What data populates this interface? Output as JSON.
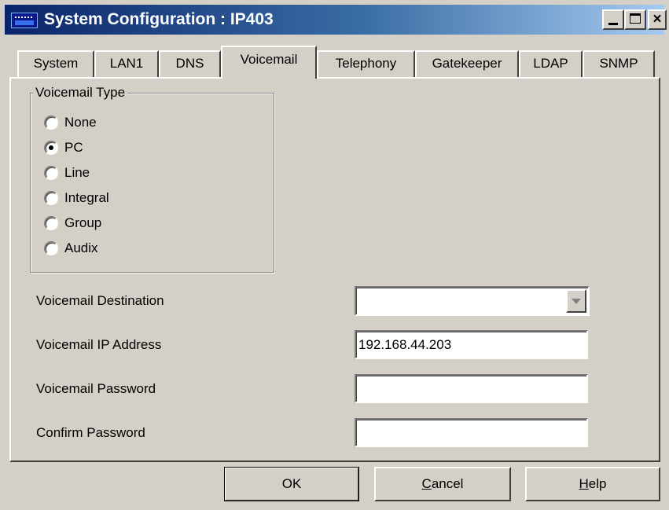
{
  "window": {
    "title": "System Configuration : IP403",
    "controls": {
      "minimize": "_",
      "maximize": "□",
      "close": "×"
    }
  },
  "tabs": [
    {
      "label": "System",
      "active": false
    },
    {
      "label": "LAN1",
      "active": false
    },
    {
      "label": "DNS",
      "active": false
    },
    {
      "label": "Voicemail",
      "active": true
    },
    {
      "label": "Telephony",
      "active": false
    },
    {
      "label": "Gatekeeper",
      "active": false
    },
    {
      "label": "LDAP",
      "active": false
    },
    {
      "label": "SNMP",
      "active": false
    }
  ],
  "voicemail_type": {
    "label": "Voicemail Type",
    "options": [
      {
        "label": "None",
        "selected": false
      },
      {
        "label": "PC",
        "selected": true
      },
      {
        "label": "Line",
        "selected": false
      },
      {
        "label": "Integral",
        "selected": false
      },
      {
        "label": "Group",
        "selected": false
      },
      {
        "label": "Audix",
        "selected": false
      }
    ]
  },
  "fields": {
    "destination": {
      "label": "Voicemail Destination",
      "value": ""
    },
    "ip_address": {
      "label": "Voicemail IP Address",
      "value": "192.168.44.203"
    },
    "password": {
      "label": "Voicemail Password",
      "value": ""
    },
    "confirm_password": {
      "label": "Confirm Password",
      "value": ""
    }
  },
  "buttons": {
    "ok": "OK",
    "cancel_first": "C",
    "cancel_rest": "ancel",
    "help_first": "H",
    "help_rest": "elp"
  }
}
